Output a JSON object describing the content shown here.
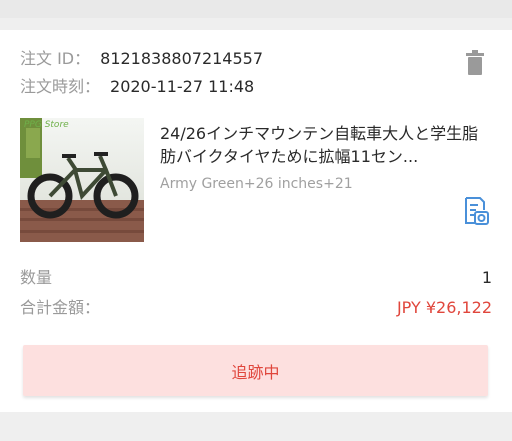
{
  "order": {
    "id_label": "注文 ID：",
    "id_value": "8121838807214557",
    "time_label": "注文時刻：",
    "time_value": "2020-11-27 11:48"
  },
  "product": {
    "image_icon": "mountain-bike-photo",
    "image_watermark": "PPG Store",
    "title": "24/26インチマウンテン自転車大人と学生脂肪バイクタイヤために拡幅11セン...",
    "variant": "Army Green+26 inches+21"
  },
  "summary": {
    "qty_label": "数量",
    "qty_value": "1",
    "total_label": "合計金額：",
    "total_value": "JPY ¥26,122"
  },
  "actions": {
    "track_label": "追跡中"
  },
  "colors": {
    "accent": "#e0463c",
    "button_bg": "#fde0df",
    "icon_blue": "#4a90d9",
    "trash_gray": "#9a9a9a"
  },
  "icons": {
    "delete": "trash-icon",
    "receipt": "receipt-search-icon"
  }
}
